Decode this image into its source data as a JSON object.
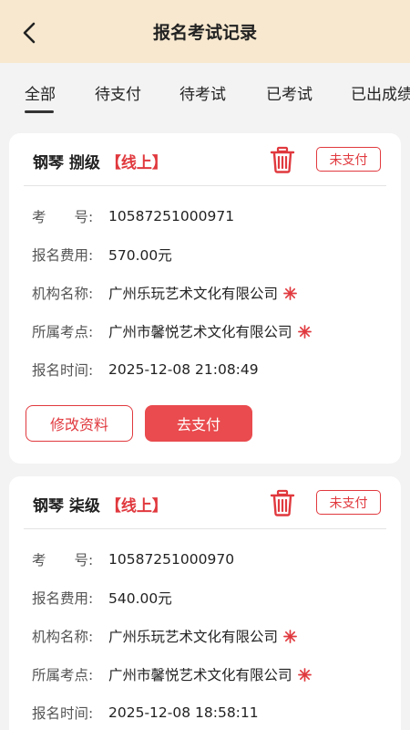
{
  "header": {
    "title": "报名考试记录"
  },
  "tabs": [
    {
      "label": "全部",
      "active": true
    },
    {
      "label": "待支付"
    },
    {
      "label": "待考试"
    },
    {
      "label": "已考试"
    },
    {
      "label": "已出成绩"
    }
  ],
  "labels": {
    "exam_no": "考　　号:",
    "fee": "报名费用:",
    "org": "机构名称:",
    "site": "所属考点:",
    "time": "报名时间:"
  },
  "records": [
    {
      "course": "钢琴 捌级",
      "mode": "【线上】",
      "status": "未支付",
      "exam_no": "10587251000971",
      "fee": "570.00元",
      "org": "广州乐玩艺术文化有限公司",
      "site": "广州市馨悦艺术文化有限公司",
      "time": "2025-12-08 21:08:49",
      "edit_label": "修改资料",
      "pay_label": "去支付"
    },
    {
      "course": "钢琴 柒级",
      "mode": "【线上】",
      "status": "未支付",
      "exam_no": "10587251000970",
      "fee": "540.00元",
      "org": "广州乐玩艺术文化有限公司",
      "site": "广州市馨悦艺术文化有限公司",
      "time": "2025-12-08 18:58:11"
    }
  ],
  "colors": {
    "accent": "#e0393e",
    "header_bg": "#f7e8cf",
    "pay_button": "#e94b4e"
  },
  "icons": {
    "back": "chevron-left-icon",
    "delete": "trash-icon",
    "verified": "snowflake-badge-icon"
  }
}
